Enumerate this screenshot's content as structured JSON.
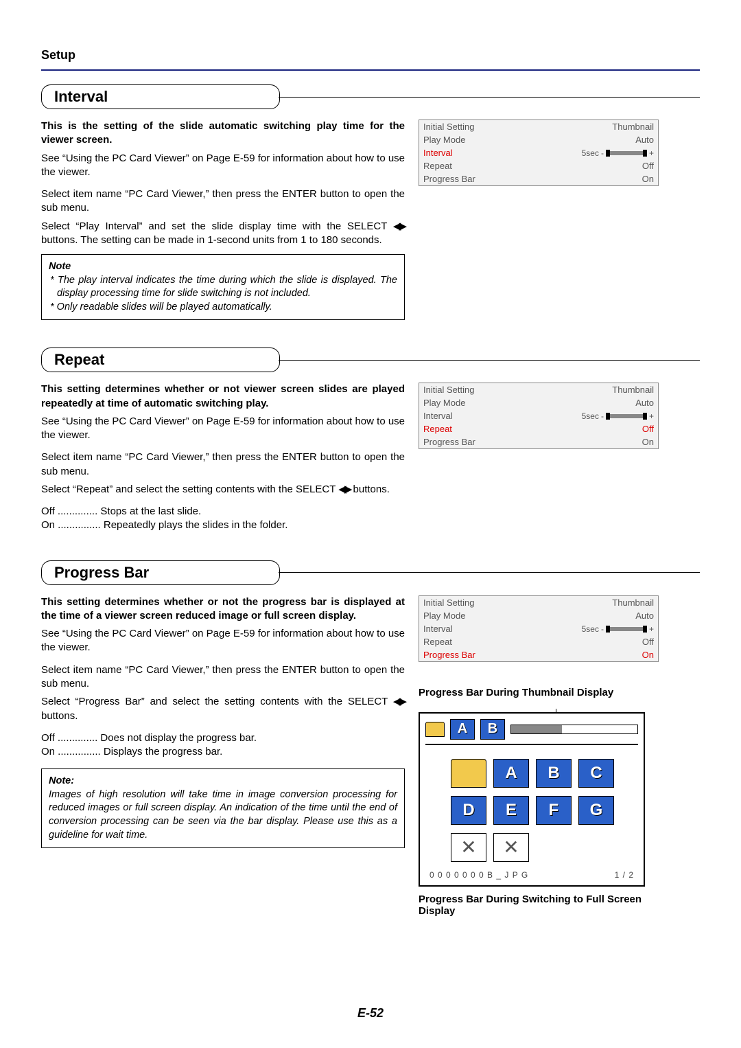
{
  "header": {
    "section": "Setup"
  },
  "interval": {
    "title": "Interval",
    "p1": "This is the setting of the slide automatic switching play time for the viewer screen.",
    "p2": "See “Using the PC Card Viewer” on Page E-59 for information about how to use the viewer.",
    "p3": "Select item name “PC Card Viewer,” then press the ENTER button to open the sub menu.",
    "p4a": "Select “Play Interval” and set the slide display time with the SELECT ",
    "p4b": " buttons. The setting can be made in 1-second units from 1 to 180 seconds.",
    "note_title": "Note",
    "note1": "* The play interval indicates the time during which the slide is displayed. The display processing time for slide switching is not included.",
    "note2": "* Only readable slides will be played automatically."
  },
  "repeat": {
    "title": "Repeat",
    "p1": "This setting determines whether or not viewer screen slides are played repeatedly at time of automatic switching play.",
    "p2": "See “Using the PC Card Viewer” on Page E-59 for information about how to use the viewer.",
    "p3": "Select item name “PC Card Viewer,” then press the ENTER button to open the sub menu.",
    "p4a": "Select “Repeat” and select the setting contents with the SELECT ",
    "p4b": " buttons.",
    "off_label": "Off",
    "off_dot": " .............. ",
    "off_text": "Stops at the last slide.",
    "on_label": "On",
    "on_dot": " ............... ",
    "on_text": "Repeatedly plays the slides in the folder."
  },
  "progress": {
    "title": "Progress Bar",
    "p1": "This setting determines whether or not the progress bar is displayed at the time of a viewer screen reduced image or full screen display.",
    "p2": "See “Using the PC Card Viewer” on Page E-59 for information about how to use the viewer.",
    "p3": "Select item name “PC Card Viewer,” then press the ENTER button to open the sub menu.",
    "p4a": "Select “Progress Bar” and select the setting contents with the SELECT ",
    "p4b": " buttons.",
    "off_label": "Off",
    "off_dot": " .............. ",
    "off_text": "Does not display the progress bar.",
    "on_label": "On",
    "on_dot": " ............... ",
    "on_text": "Displays the progress bar.",
    "note_title": "Note:",
    "note_body": "Images of high resolution will take time in image conversion processing for reduced images or full screen display. An indication of the time until the end of conversion processing can be seen via the bar display. Please use this as a guideline for wait time.",
    "caption1": "Progress Bar During Thumbnail Display",
    "caption2": "Progress Bar During Switching to Full Screen Display"
  },
  "osd_common": {
    "rows": [
      {
        "l": "Initial Setting",
        "r": "Thumbnail"
      },
      {
        "l": "Play Mode",
        "r": "Auto"
      },
      {
        "l": "Interval",
        "r": "5sec"
      },
      {
        "l": "Repeat",
        "r": "Off"
      },
      {
        "l": "Progress Bar",
        "r": "On"
      }
    ]
  },
  "thumb": {
    "letters_top": [
      "A",
      "B"
    ],
    "letters_grid": [
      "A",
      "B",
      "C",
      "D",
      "E",
      "F",
      "G"
    ],
    "filename": "0 0 0 0 0 0 0 B _ J P G",
    "page": "1 /  2"
  },
  "arrows": "◀▶",
  "page_number": "E-52"
}
